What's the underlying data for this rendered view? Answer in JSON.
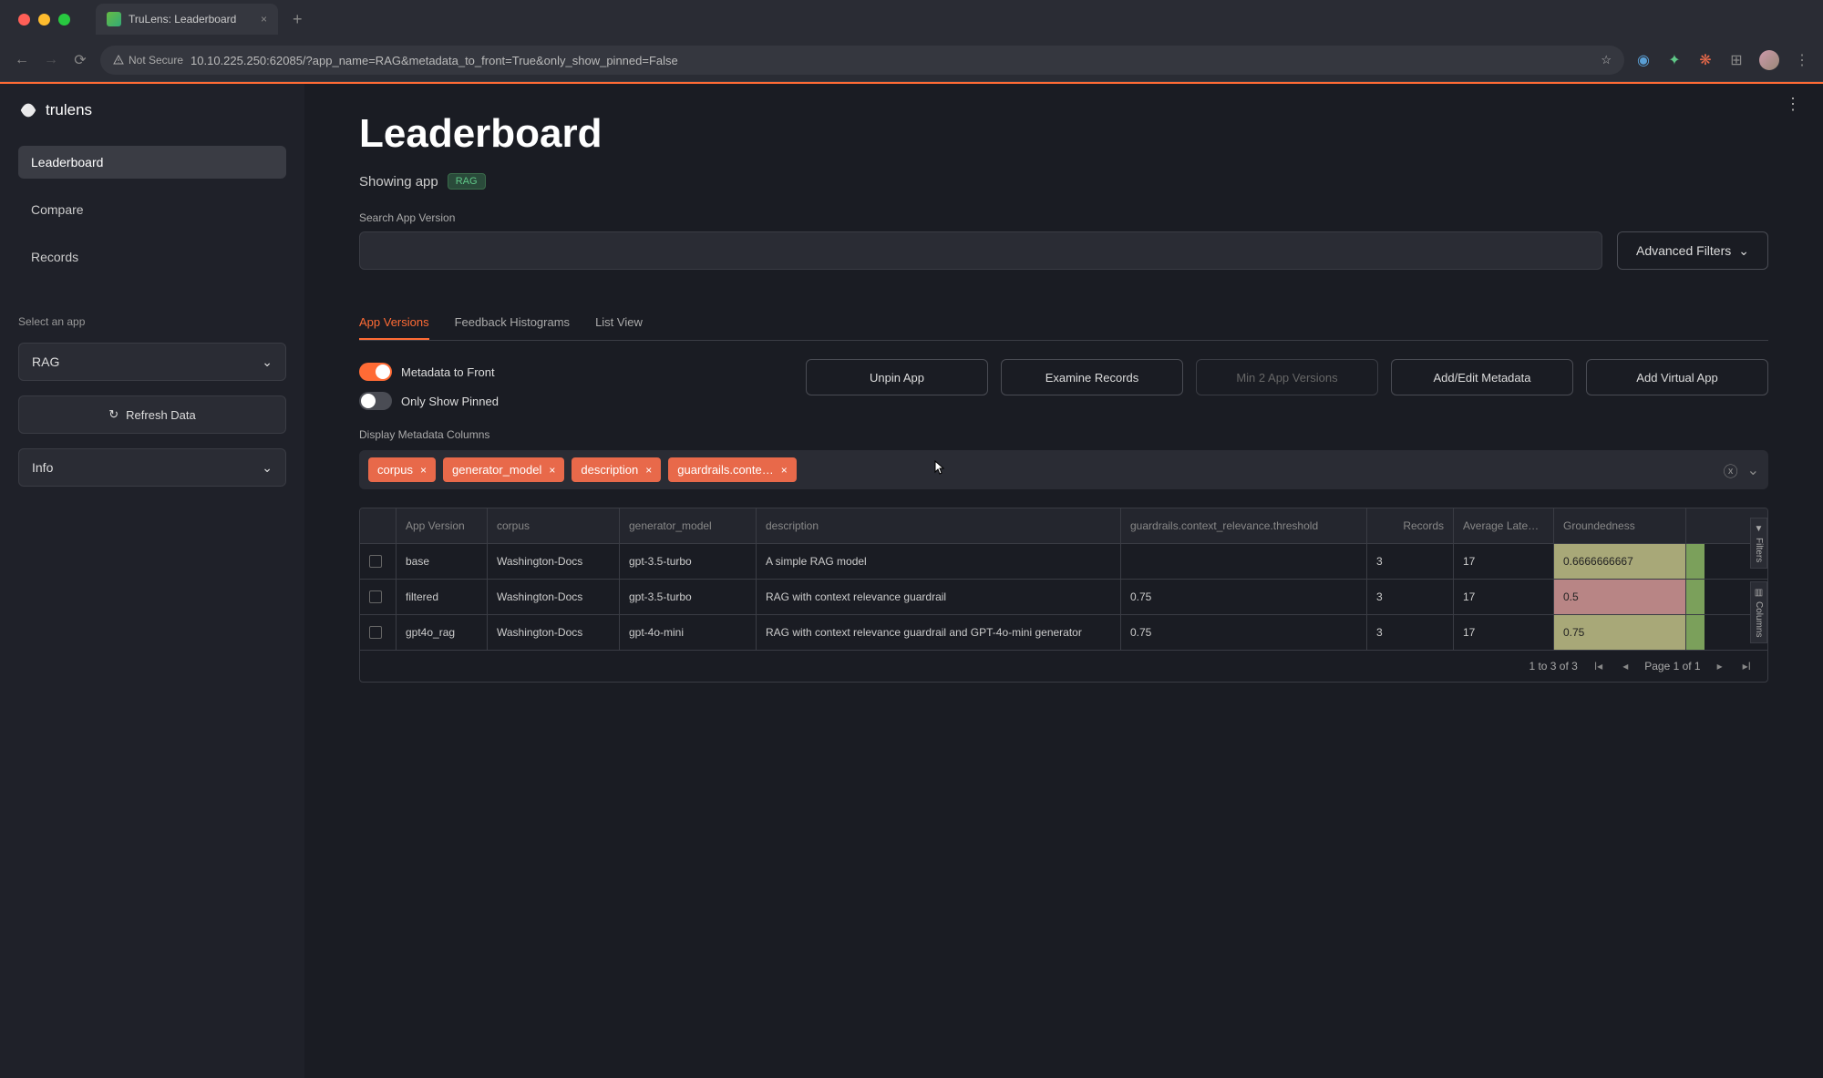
{
  "browser": {
    "tab_title": "TruLens: Leaderboard",
    "url": "10.10.225.250:62085/?app_name=RAG&metadata_to_front=True&only_show_pinned=False",
    "not_secure": "Not Secure"
  },
  "sidebar": {
    "logo": "trulens",
    "nav": [
      "Leaderboard",
      "Compare",
      "Records"
    ],
    "select_label": "Select an app",
    "selected_app": "RAG",
    "refresh": "Refresh Data",
    "info": "Info"
  },
  "page": {
    "title": "Leaderboard",
    "showing_prefix": "Showing app",
    "showing_app": "RAG",
    "search_label": "Search App Version",
    "adv_filters": "Advanced Filters",
    "tabs": [
      "App Versions",
      "Feedback Histograms",
      "List View"
    ],
    "toggle_meta": "Metadata to Front",
    "toggle_pinned": "Only Show Pinned",
    "actions": {
      "unpin": "Unpin App",
      "examine": "Examine Records",
      "min2": "Min 2 App Versions",
      "addmeta": "Add/Edit Metadata",
      "addvirt": "Add Virtual App"
    },
    "meta_cols_label": "Display Metadata Columns",
    "chips": [
      "corpus",
      "generator_model",
      "description",
      "guardrails.conte…"
    ]
  },
  "table": {
    "headers": {
      "ver": "App Version",
      "corpus": "corpus",
      "gen": "generator_model",
      "desc": "description",
      "guard": "guardrails.context_relevance.threshold",
      "rec": "Records",
      "lat": "Average Latency",
      "ground": "Groundedness"
    },
    "rows": [
      {
        "ver": "base",
        "corpus": "Washington-Docs",
        "gen": "gpt-3.5-turbo",
        "desc": "A simple RAG model",
        "guard": "",
        "rec": "3",
        "lat": "17",
        "ground": "0.6666666667",
        "gclass": "ground-mid"
      },
      {
        "ver": "filtered",
        "corpus": "Washington-Docs",
        "gen": "gpt-3.5-turbo",
        "desc": "RAG with context relevance guardrail",
        "guard": "0.75",
        "rec": "3",
        "lat": "17",
        "ground": "0.5",
        "gclass": "ground-bad"
      },
      {
        "ver": "gpt4o_rag",
        "corpus": "Washington-Docs",
        "gen": "gpt-4o-mini",
        "desc": "RAG with context relevance guardrail and GPT-4o-mini generator",
        "guard": "0.75",
        "rec": "3",
        "lat": "17",
        "ground": "0.75",
        "gclass": "ground-mid"
      }
    ],
    "side_tabs": {
      "filters": "Filters",
      "columns": "Columns"
    },
    "pager": {
      "range": "1 to 3 of 3",
      "page": "Page 1 of 1"
    }
  }
}
